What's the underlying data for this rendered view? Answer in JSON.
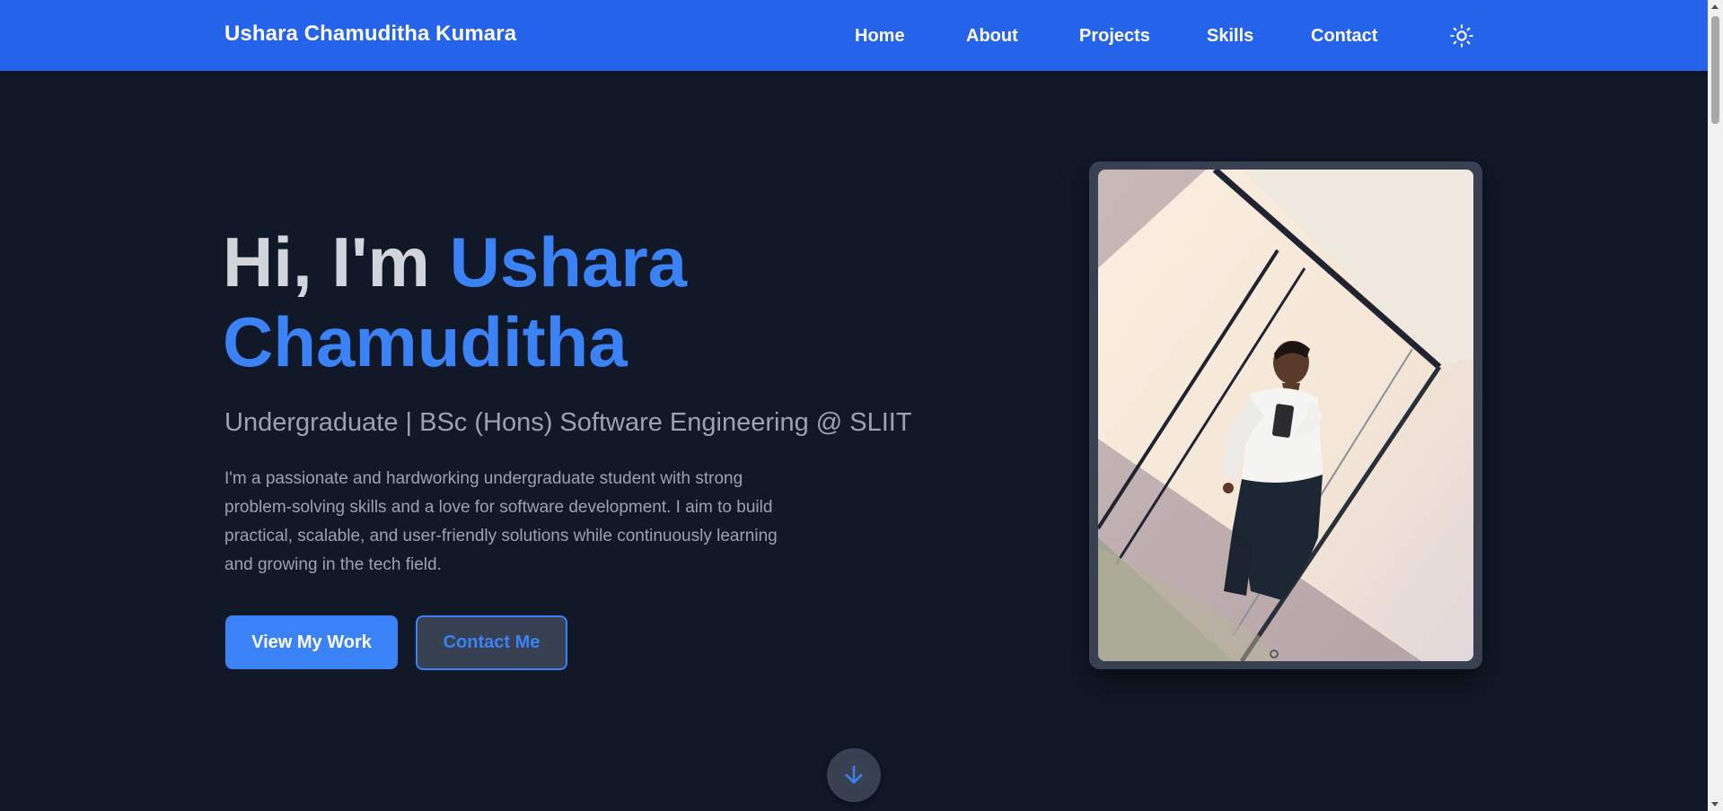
{
  "navbar": {
    "brand": "Ushara Chamuditha Kumara",
    "links": [
      {
        "label": "Home"
      },
      {
        "label": "About"
      },
      {
        "label": "Projects"
      },
      {
        "label": "Skills"
      },
      {
        "label": "Contact"
      }
    ],
    "theme_toggle_icon": "sun-icon",
    "background_color": "#2563eb"
  },
  "hero": {
    "greeting": "Hi, I'm ",
    "name_line1": "Ushara",
    "name_line2": "Chamuditha",
    "subtitle": "Undergraduate | BSc (Hons) Software Engineering @ SLIIT",
    "bio": "I'm a passionate and hardworking undergraduate student with strong problem-solving skills and a love for software development. I aim to build practical, scalable, and user-friendly solutions while continuously learning and growing in the tech field.",
    "primary_button": "View My Work",
    "secondary_button": "Contact Me",
    "profile_photo": "profile-photo",
    "scroll_icon": "arrow-down-icon"
  },
  "colors": {
    "background": "#111827",
    "accent": "#3b82f6",
    "heading": "#d1d5db",
    "muted_text": "#9ca3af",
    "surface": "#374151"
  }
}
